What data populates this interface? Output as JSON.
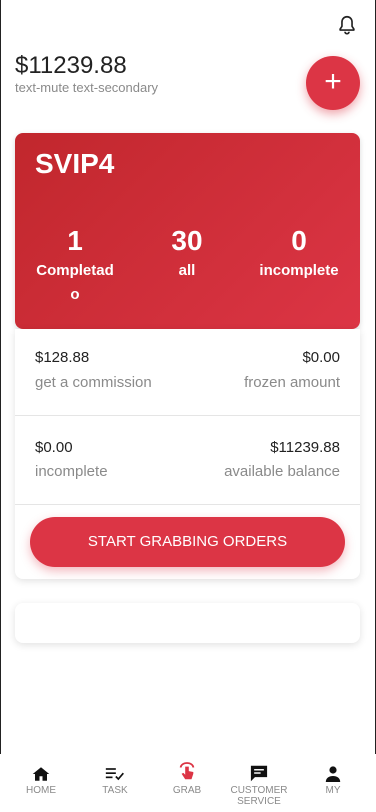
{
  "header": {
    "balance": "$11239.88",
    "balance_sub": "text-mute text-secondary",
    "add_label": "+"
  },
  "vip_card": {
    "level": "SVIP4",
    "stats": [
      {
        "value": "1",
        "label": "Completado"
      },
      {
        "value": "30",
        "label": "all"
      },
      {
        "value": "0",
        "label": "incomplete"
      }
    ]
  },
  "details": {
    "commission_value": "$128.88",
    "commission_label": "get a commission",
    "frozen_value": "$0.00",
    "frozen_label": "frozen amount",
    "incomplete_value": "$0.00",
    "incomplete_label": "incomplete",
    "available_value": "$11239.88",
    "available_label": "available balance",
    "grab_button": "START GRABBING ORDERS"
  },
  "tabbar": {
    "home": "HOME",
    "task": "TASK",
    "grab": "GRAB",
    "customer_service": "CUSTOMER SERVICE",
    "my": "MY"
  },
  "colors": {
    "accent": "#dc3545",
    "accent_dark": "#c1272d",
    "muted": "#8a8a8a"
  },
  "icons": [
    "bell-icon",
    "plus-icon",
    "home-icon",
    "task-icon",
    "grab-icon",
    "chat-icon",
    "person-icon"
  ]
}
